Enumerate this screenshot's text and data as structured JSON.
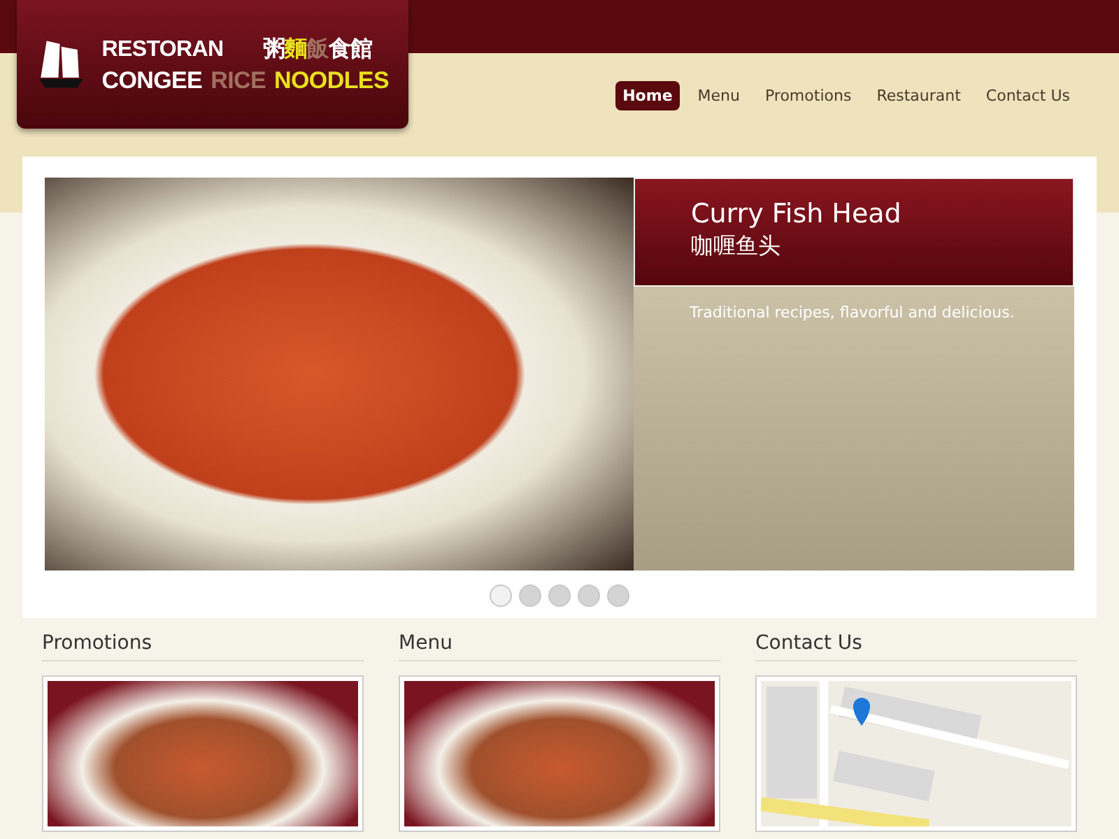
{
  "logo": {
    "top_left": "RESTORAN",
    "top_right": [
      {
        "text": "粥",
        "color": "#ffffff"
      },
      {
        "text": "麵",
        "color": "#e8e020"
      },
      {
        "text": "飯",
        "color": "#a07060"
      },
      {
        "text": "食館",
        "color": "#ffffff"
      }
    ],
    "bottom": [
      {
        "text": "CONGEE",
        "color": "#ffffff"
      },
      {
        "text": "RICE",
        "color": "#a07060"
      },
      {
        "text": "NOODLES",
        "color": "#e8e020"
      }
    ]
  },
  "nav": [
    {
      "label": "Home",
      "selected": true
    },
    {
      "label": "Menu",
      "selected": false
    },
    {
      "label": "Promotions",
      "selected": false
    },
    {
      "label": "Restaurant",
      "selected": false
    },
    {
      "label": "Contact Us",
      "selected": false
    }
  ],
  "slide": {
    "title": "Curry Fish Head",
    "subtitle": "咖喱鱼头",
    "text": "Traditional recipes, flavorful and delicious."
  },
  "slider_dots": [
    {
      "selected": true
    },
    {
      "selected": false
    },
    {
      "selected": false
    },
    {
      "selected": false
    },
    {
      "selected": false
    }
  ],
  "sections": [
    {
      "heading": "Promotions",
      "kind": "photo"
    },
    {
      "heading": "Menu",
      "kind": "photo"
    },
    {
      "heading": "Contact Us",
      "kind": "map"
    }
  ]
}
